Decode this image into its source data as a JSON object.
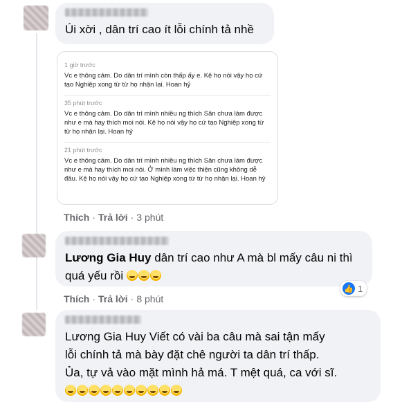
{
  "comments": [
    {
      "text": "Úi xời , dân trí cao ít lỗi chính tả nhề",
      "edit_history": [
        {
          "time": "1 giờ trước",
          "text": "Vc e thông cảm. Do dân trí mình còn thấp ấy e. Kệ họ nói vậy họ cứ tạo Nghiệp xong từ từ họ nhận lại. Hoan hỷ"
        },
        {
          "time": "35 phút trước",
          "text": "Vc e thông cảm. Do dân trí mình nhiều ng thích Sân chưa làm được như e mà hay thích moi nói. Kệ họ nói vậy họ cứ tạo Nghiệp xong từ từ họ nhận lại. Hoan hỷ"
        },
        {
          "time": "21 phút trước",
          "text": "Vc e thông cảm. Do dân trí mình nhiều ng thích Sân chưa làm được như e mà hay thích moi nói. Ở mình làm việc thiện cũng không dễ đâu. Kệ họ nói vậy họ cứ tạo Nghiệp xong từ từ họ nhận lại. Hoan hỷ"
        }
      ],
      "like_label": "Thích",
      "reply_label": "Trả lời",
      "time": "3 phút"
    },
    {
      "mention": "Lương Gia Huy",
      "text": "dân trí cao như A mà bl mấy câu ni thì quá yếu rồi",
      "emojis": [
        "laugh-cry",
        "laugh-cry",
        "laugh-cry"
      ],
      "reaction_count": "1",
      "reaction_icon": "like-icon",
      "like_label": "Thích",
      "reply_label": "Trả lời",
      "time": "8 phút"
    },
    {
      "text": "Lương Gia Huy Viết có vài ba câu mà sai tận mấy lỗi chính tả mà bày đặt chê người ta dân trí thấp. Ủa, tự vả vào mặt mình hả má. T mệt quá, ca với sĩ.",
      "line1": "Lương Gia Huy Viết có vài ba câu mà sai tận mấy",
      "line2": "lỗi chính tả mà bày đặt chê người ta dân trí thấp.",
      "line3": "Ủa, tự vả vào mặt mình hả má. T mệt quá, ca với sĩ.",
      "emojis": [
        "smile",
        "smile",
        "smile",
        "smile",
        "smile",
        "laugh-cry",
        "laugh-cry",
        "laugh-cry",
        "laugh-cry",
        "laugh-cry"
      ]
    }
  ],
  "colors": {
    "bubble": "#f0f2f5",
    "meta_text": "#65676b",
    "like_blue": "#1877f2"
  }
}
